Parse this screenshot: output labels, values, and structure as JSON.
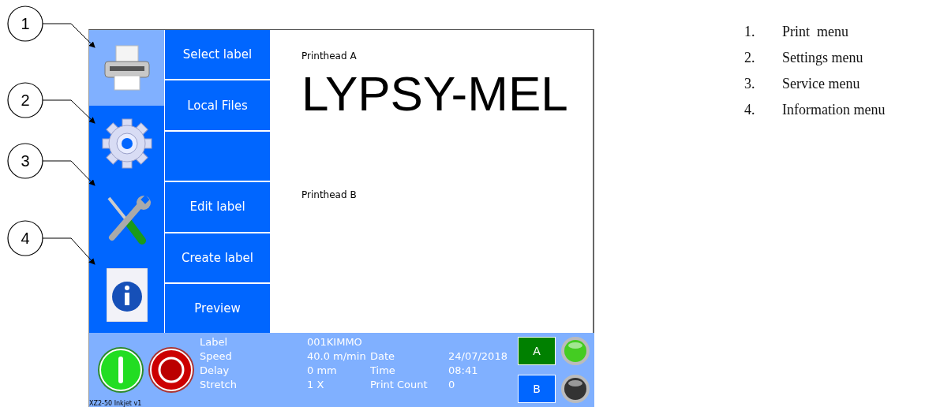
{
  "callouts": [
    {
      "number": "1"
    },
    {
      "number": "2"
    },
    {
      "number": "3"
    },
    {
      "number": "4"
    }
  ],
  "screen": {
    "menu_icons": [
      {
        "kind": "printer",
        "selected": true
      },
      {
        "kind": "gear",
        "selected": false
      },
      {
        "kind": "tools",
        "selected": false
      },
      {
        "kind": "info",
        "selected": false
      }
    ],
    "submenu": [
      {
        "kind": "button",
        "label": "Select label"
      },
      {
        "kind": "button",
        "label": "Local Files"
      },
      {
        "kind": "blank"
      },
      {
        "kind": "button",
        "label": "Edit label"
      },
      {
        "kind": "button",
        "label": "Create label"
      },
      {
        "kind": "button",
        "label": "Preview"
      }
    ],
    "preview": {
      "printhead_a": "Printhead A",
      "label_text": "LYPSY-MEL",
      "printhead_b": "Printhead B"
    },
    "status_bar": {
      "rows": [
        [
          {
            "name": "Label",
            "value": "001KIMMO"
          }
        ],
        [
          {
            "name": "Speed",
            "value": "40.0 m/min"
          },
          {
            "name": "Date",
            "value": "24/07/2018"
          }
        ],
        [
          {
            "name": "Delay",
            "value": "0 mm"
          },
          {
            "name": "Time",
            "value": "08:41"
          }
        ],
        [
          {
            "name": "Stretch",
            "value": "1 X"
          },
          {
            "name": "Print Count",
            "value": "0"
          }
        ]
      ],
      "printheads": [
        {
          "name": "A",
          "color": "#008000",
          "on": true
        },
        {
          "name": "B",
          "color": "#0066ff",
          "on": false
        }
      ],
      "version": "XZ2-50 Inkjet v1"
    }
  },
  "legend": [
    {
      "number": "1.",
      "text": "Print  menu"
    },
    {
      "number": "2.",
      "text": "Settings menu"
    },
    {
      "number": "3.",
      "text": "Service menu"
    },
    {
      "number": "4.",
      "text": "Information menu"
    }
  ]
}
